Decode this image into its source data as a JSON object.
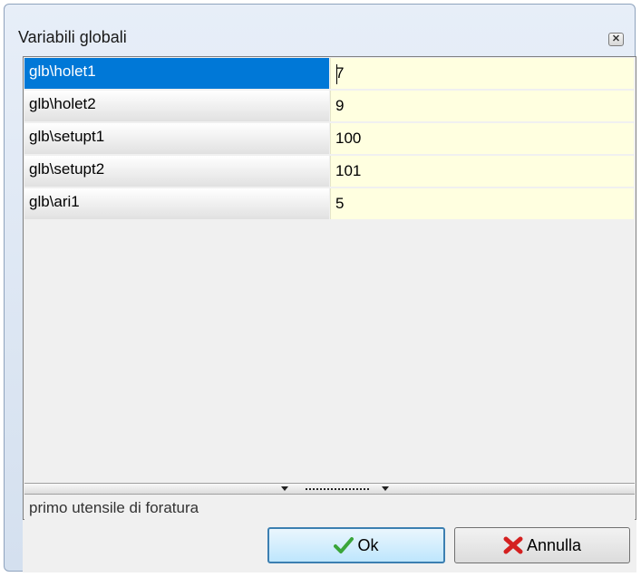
{
  "window": {
    "title": "Variabili globali",
    "close_icon": "close-icon"
  },
  "grid": {
    "rows": [
      {
        "name": "glb\\holet1",
        "value": "7",
        "selected": true
      },
      {
        "name": "glb\\holet2",
        "value": "9",
        "selected": false
      },
      {
        "name": "glb\\setupt1",
        "value": "100",
        "selected": false
      },
      {
        "name": "glb\\setupt2",
        "value": "101",
        "selected": false
      },
      {
        "name": "glb\\ari1",
        "value": "5",
        "selected": false
      }
    ],
    "selected_color": "#0078d7",
    "value_bg_color": "#ffffe0"
  },
  "description": {
    "text": "primo utensile di foratura"
  },
  "buttons": {
    "ok_label": "Ok",
    "ok_icon": "checkmark-icon",
    "cancel_label": "Annulla",
    "cancel_icon": "red-x-icon"
  }
}
